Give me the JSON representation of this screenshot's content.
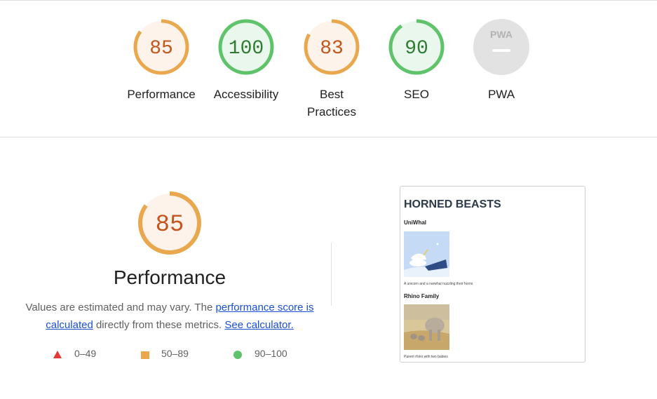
{
  "colors": {
    "average": "#e9a84e",
    "average_text": "#c3561d",
    "average_fill": "#fdf3ea",
    "pass": "#5ec36a",
    "pass_text": "#2e7d32",
    "pass_fill": "#eaf7ec",
    "fail": "#e53935",
    "pwa_fill": "#e2e2e2",
    "link": "#1a4fd6"
  },
  "gauges": [
    {
      "name": "performance",
      "score": "85",
      "value": 85,
      "label": "Performance"
    },
    {
      "name": "accessibility",
      "score": "100",
      "value": 100,
      "label": "Accessibility"
    },
    {
      "name": "best-practices",
      "score": "83",
      "value": 83,
      "label": "Best Practices"
    },
    {
      "name": "seo",
      "score": "90",
      "value": 90,
      "label": "SEO"
    },
    {
      "name": "pwa",
      "score": "",
      "value": 0,
      "label": "PWA",
      "badge": "PWA"
    }
  ],
  "performance": {
    "score": "85",
    "value": 85,
    "title": "Performance",
    "desc_prefix": "Values are estimated and may vary. The ",
    "desc_link": "performance score is calculated",
    "desc_middle": " directly from these metrics. ",
    "calc_link": "See calculator."
  },
  "legend": [
    {
      "icon": "fail-triangle-icon",
      "range": "0–49"
    },
    {
      "icon": "average-square-icon",
      "range": "50–89"
    },
    {
      "icon": "pass-circle-icon",
      "range": "90–100"
    }
  ],
  "screenshot": {
    "title": "HORNED BEASTS",
    "item1_title": "UniWhal",
    "item1_caption": "A unicorn and a narwhal nuzzling their horns",
    "item2_title": "Rhino Family",
    "item2_caption": "Parent rhino with two babies"
  }
}
